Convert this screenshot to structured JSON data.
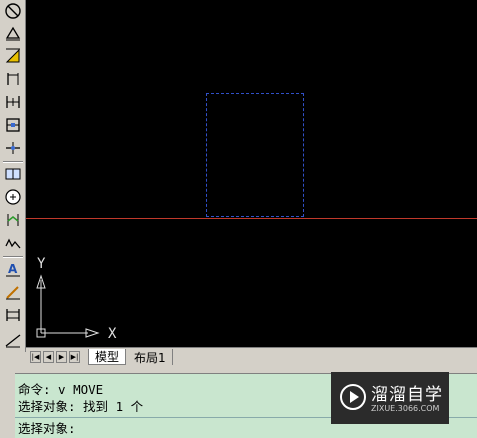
{
  "toolbar": {
    "tools": [
      {
        "name": "linear-dimension-icon"
      },
      {
        "name": "aligned-dimension-icon"
      },
      {
        "name": "arc-length-icon"
      },
      {
        "name": "ordinate-dimension-icon"
      },
      {
        "name": "baseline-dimension-icon"
      },
      {
        "name": "continue-dimension-icon"
      },
      {
        "name": "quick-leader-icon"
      },
      {
        "name": "tolerance-icon"
      },
      {
        "name": "center-mark-icon"
      },
      {
        "name": "jogged-dimension-icon"
      },
      {
        "name": "dimension-edit-icon"
      },
      {
        "name": "dimension-text-edit-icon"
      },
      {
        "name": "dimension-update-icon"
      },
      {
        "name": "dimension-style-icon"
      }
    ]
  },
  "canvas": {
    "ucs": {
      "x_label": "X",
      "y_label": "Y"
    },
    "line_color": "#c0392b",
    "selection_color": "#3050c8"
  },
  "tabs": {
    "model": "模型",
    "layout1": "布局1"
  },
  "command": {
    "line1": "命令: v MOVE",
    "line2": "选择对象: 找到 1 个",
    "line3": "选择对象:"
  },
  "watermark": {
    "title": "溜溜自学",
    "subtitle": "ZIXUE.3066.COM"
  }
}
